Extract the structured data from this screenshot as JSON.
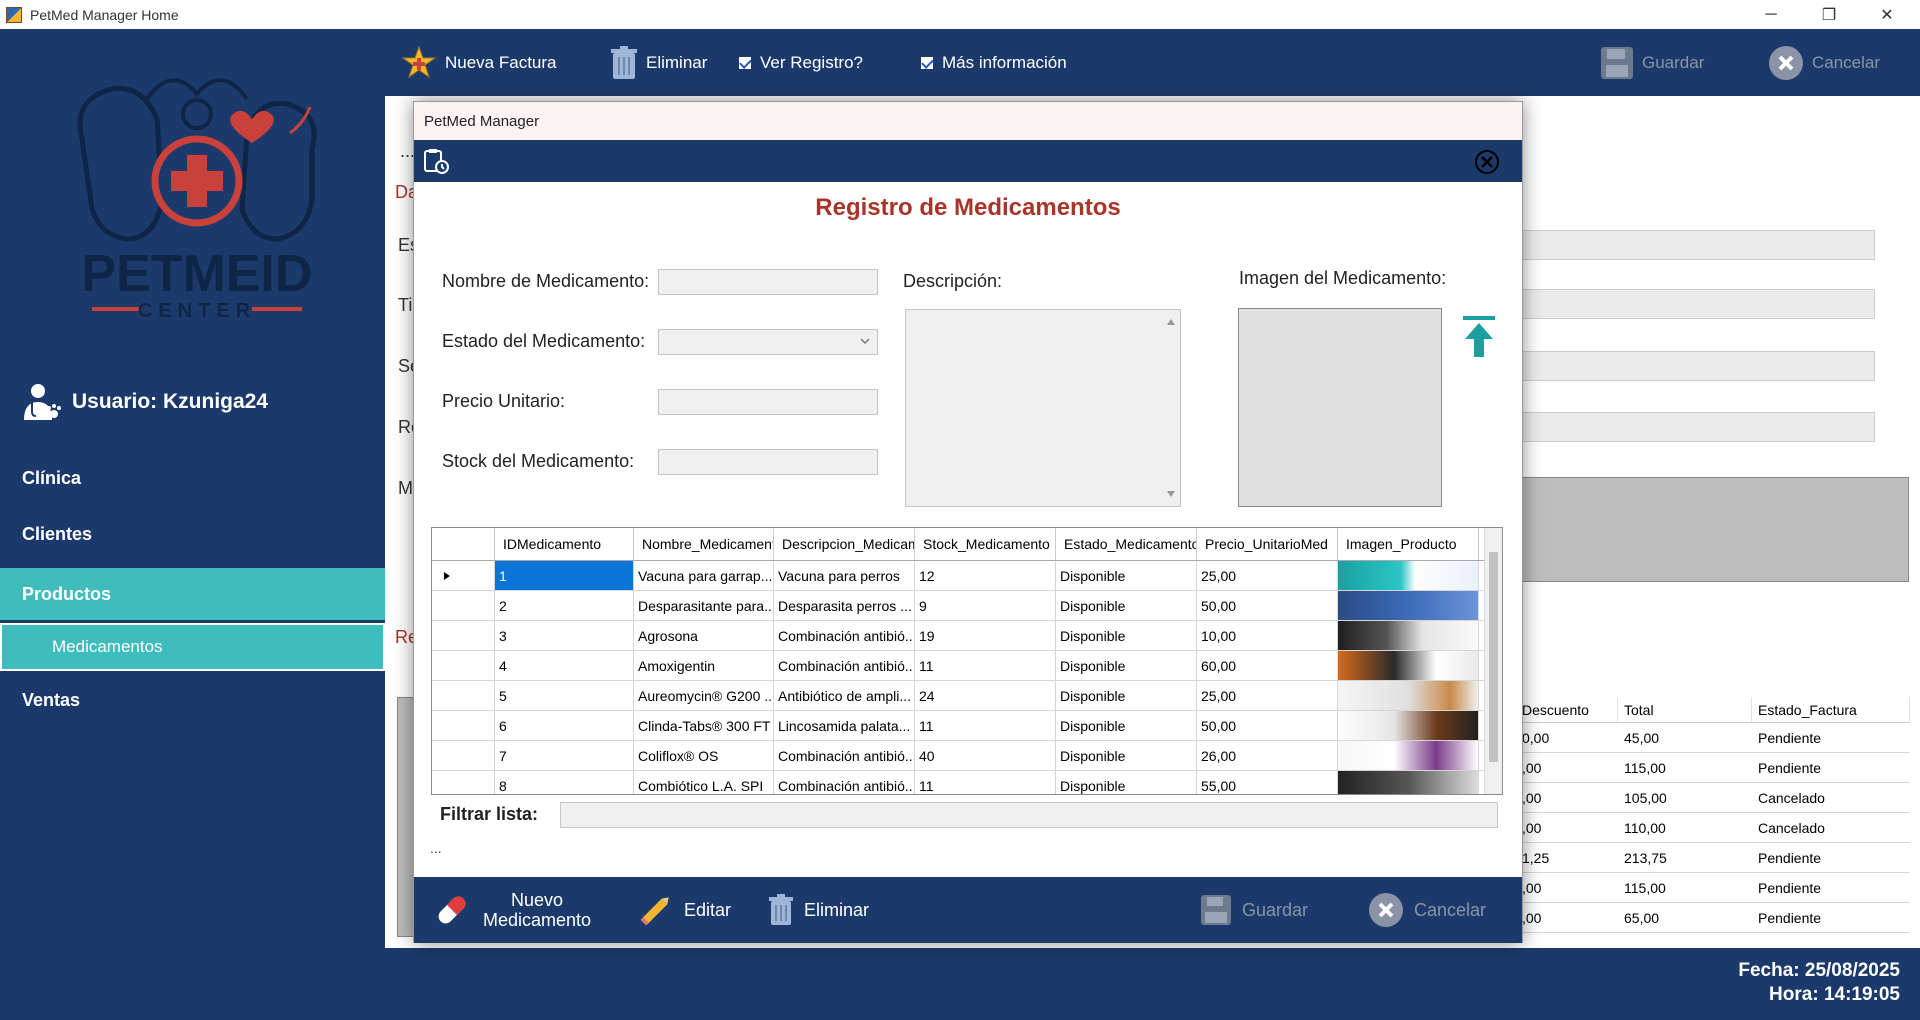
{
  "window": {
    "title": "PetMed Manager Home",
    "controls": {
      "minimize": "─",
      "restore": "❐",
      "close": "✕"
    }
  },
  "sidebar": {
    "logo_text": "PETMEID",
    "logo_sub": "CENTER",
    "user": "Usuario: Kzuniga24",
    "items": [
      {
        "label": "Clínica"
      },
      {
        "label": "Clientes"
      },
      {
        "label": "Productos"
      },
      {
        "label": "Medicamentos"
      },
      {
        "label": "Ventas"
      }
    ]
  },
  "toolbar": {
    "new_invoice": "Nueva Factura",
    "delete": "Eliminar",
    "view_record": "Ver Registro?",
    "more_info": "Más información",
    "save": "Guardar",
    "cancel": "Cancelar"
  },
  "home_fragments": {
    "ellipsis": "...",
    "da": "Da",
    "es": "Es",
    "ti": "Ti",
    "se": "Se",
    "re": "Re",
    "m": "M",
    "re2": "Re"
  },
  "bg_table": {
    "headers": [
      "Descuento",
      "Total",
      "Estado_Factura"
    ],
    "rows": [
      [
        "0,00",
        "45,00",
        "Pendiente"
      ],
      [
        ",00",
        "115,00",
        "Pendiente"
      ],
      [
        ",00",
        "105,00",
        "Cancelado"
      ],
      [
        ",00",
        "110,00",
        "Cancelado"
      ],
      [
        "1,25",
        "213,75",
        "Pendiente"
      ],
      [
        ",00",
        "115,00",
        "Pendiente"
      ],
      [
        ",00",
        "65,00",
        "Pendiente"
      ]
    ]
  },
  "footer": {
    "date": "Fecha: 25/08/2025",
    "time": "Hora: 14:19:05"
  },
  "dialog": {
    "title": "PetMed Manager",
    "heading": "Registro de Medicamentos",
    "labels": {
      "name": "Nombre de Medicamento:",
      "status": "Estado del Medicamento:",
      "price": "Precio Unitario:",
      "stock": "Stock del Medicamento:",
      "description": "Descripción:",
      "image": "Imagen del Medicamento:"
    },
    "grid": {
      "headers": [
        "IDMedicamento",
        "Nombre_Medicamento",
        "Descripcion_Medicam",
        "Stock_Medicamento",
        "Estado_Medicamento",
        "Precio_UnitarioMed",
        "Imagen_Producto"
      ],
      "rows": [
        [
          "1",
          "Vacuna para garrap...",
          "Vacuna para perros",
          "12",
          "Disponible",
          "25,00"
        ],
        [
          "2",
          "Desparasitante para...",
          "Desparasita perros ...",
          "9",
          "Disponible",
          "50,00"
        ],
        [
          "3",
          "Agrosona",
          "Combinación antibió...",
          "19",
          "Disponible",
          "10,00"
        ],
        [
          "4",
          "Amoxigentin",
          "Combinación antibió...",
          "11",
          "Disponible",
          "60,00"
        ],
        [
          "5",
          "Aureomycin® G200 ...",
          "Antibiótico de ampli...",
          "24",
          "Disponible",
          "25,00"
        ],
        [
          "6",
          "Clinda-Tabs® 300 FT",
          "Lincosamida palata...",
          "11",
          "Disponible",
          "50,00"
        ],
        [
          "7",
          "Coliflox® OS",
          "Combinación antibió...",
          "40",
          "Disponible",
          "26,00"
        ],
        [
          "8",
          "Combiótico L.A. SPI",
          "Combinación antibió...",
          "11",
          "Disponible",
          "55,00"
        ]
      ]
    },
    "filter_label": "Filtrar lista:",
    "ellipsis": "...",
    "footer_buttons": {
      "new": "Nuevo Medicamento",
      "edit": "Editar",
      "delete": "Eliminar",
      "save": "Guardar",
      "cancel": "Cancelar"
    }
  },
  "colors": {
    "navy": "#1b3a6b",
    "teal": "#3fbcbc",
    "heading_red": "#a8342a",
    "selection_blue": "#0a74d9"
  }
}
